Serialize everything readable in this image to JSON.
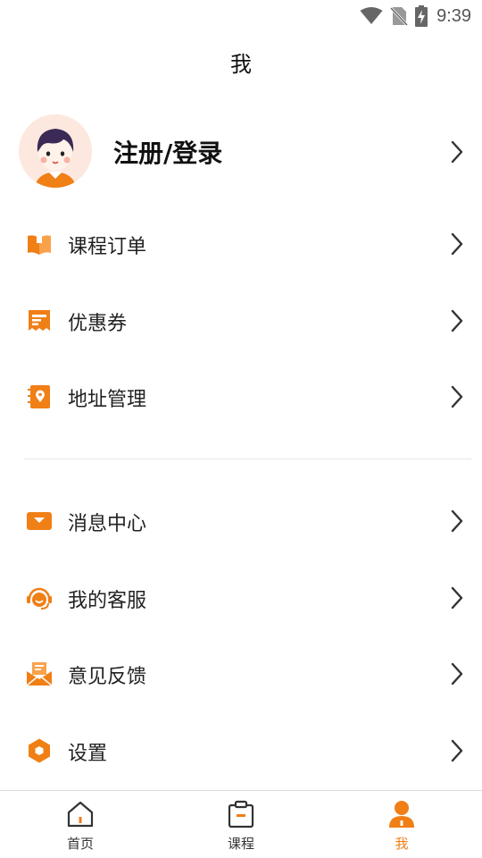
{
  "status_bar": {
    "time": "9:39"
  },
  "header": {
    "title": "我"
  },
  "profile": {
    "login_label": "注册/登录"
  },
  "menu_group_1": [
    {
      "label": "课程订单",
      "icon": "book-icon"
    },
    {
      "label": "优惠券",
      "icon": "coupon-icon"
    },
    {
      "label": "地址管理",
      "icon": "address-book-icon"
    }
  ],
  "menu_group_2": [
    {
      "label": "消息中心",
      "icon": "envelope-icon"
    },
    {
      "label": "我的客服",
      "icon": "headset-icon"
    },
    {
      "label": "意见反馈",
      "icon": "feedback-mail-icon"
    },
    {
      "label": "设置",
      "icon": "hexagon-settings-icon"
    }
  ],
  "tab_bar": {
    "tabs": [
      {
        "label": "首页",
        "icon": "home-icon",
        "active": false
      },
      {
        "label": "课程",
        "icon": "clipboard-icon",
        "active": false
      },
      {
        "label": "我",
        "icon": "person-icon",
        "active": true
      }
    ]
  },
  "colors": {
    "accent": "#f07f16",
    "text": "#222222",
    "divider": "#e6e6e6"
  }
}
